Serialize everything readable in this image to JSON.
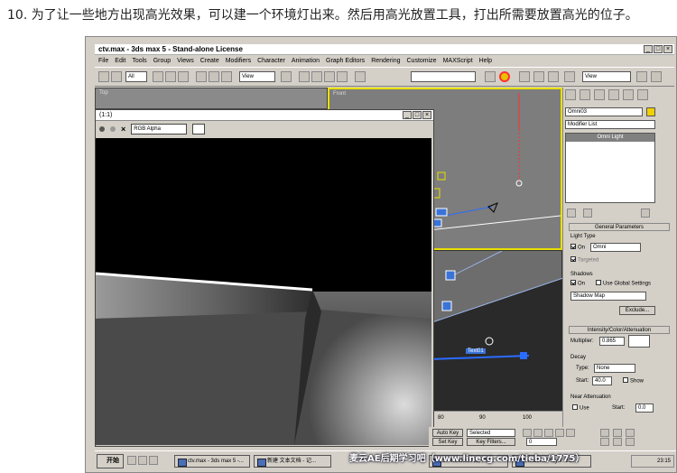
{
  "heading": "10. 为了让一些地方出现高光效果，可以建一个环境灯出来。然后用高光放置工具，打出所需要放置高光的位子。",
  "window_title": "ctv.max - 3ds max 5 - Stand-alone License",
  "menu": [
    "File",
    "Edit",
    "Tools",
    "Group",
    "Views",
    "Create",
    "Modifiers",
    "Character",
    "Animation",
    "Graph Editors",
    "Rendering",
    "Customize",
    "MAXScript",
    "Help"
  ],
  "toolbar": {
    "selection_filter": "All",
    "ref_coord": "View",
    "named_set": "View"
  },
  "viewports": {
    "top_label": "Top",
    "front_label": "Front"
  },
  "render_window": {
    "title": "(1:1)",
    "channel": "RGB Alpha"
  },
  "command_panel": {
    "object_name": "Omni03",
    "modifier_list": "Modifier List",
    "stack_item": "Omni Light",
    "rollout_general": "General Parameters",
    "light_type_label": "Light Type",
    "on_label": "On",
    "light_type_value": "Omni",
    "targeted_label": "Targeted",
    "shadows_label": "Shadows",
    "use_global_label": "Use Global Settings",
    "shadow_type": "Shadow Map",
    "exclude_label": "Exclude...",
    "rollout_intensity": "Intensity/Color/Attenuation",
    "multiplier_label": "Multiplier:",
    "multiplier_value": "0.865",
    "decay_label": "Decay",
    "decay_type_label": "Type:",
    "decay_type": "None",
    "start_label": "Start:",
    "start_value": "40.0",
    "show_label": "Show",
    "near_atten_label": "Near Attenuation",
    "use_label": "Use",
    "near_start_value": "0.0"
  },
  "timeline": {
    "ticks": [
      "80",
      "90",
      "100"
    ]
  },
  "scene_label": "Text01",
  "anim_controls": {
    "auto_key": "Auto Key",
    "selected": "Selected",
    "set_key": "Set Key",
    "key_filters": "Key Filters...",
    "frame": "0"
  },
  "taskbar": {
    "start": "开始",
    "items": [
      "ctv.max - 3ds max 5 -...",
      "新建 文本文档 - 记...",
      "3 - Windows 图片和...",
      "Realone Player: 310..."
    ],
    "clock": "23:15"
  },
  "watermark": "麦云AE后期学习吧（www.linecg.com/tieba/1775）",
  "colors": {
    "viewport_active": "#e8e000",
    "render_bg": "#000000",
    "selection_highlight": "#ff3030"
  }
}
